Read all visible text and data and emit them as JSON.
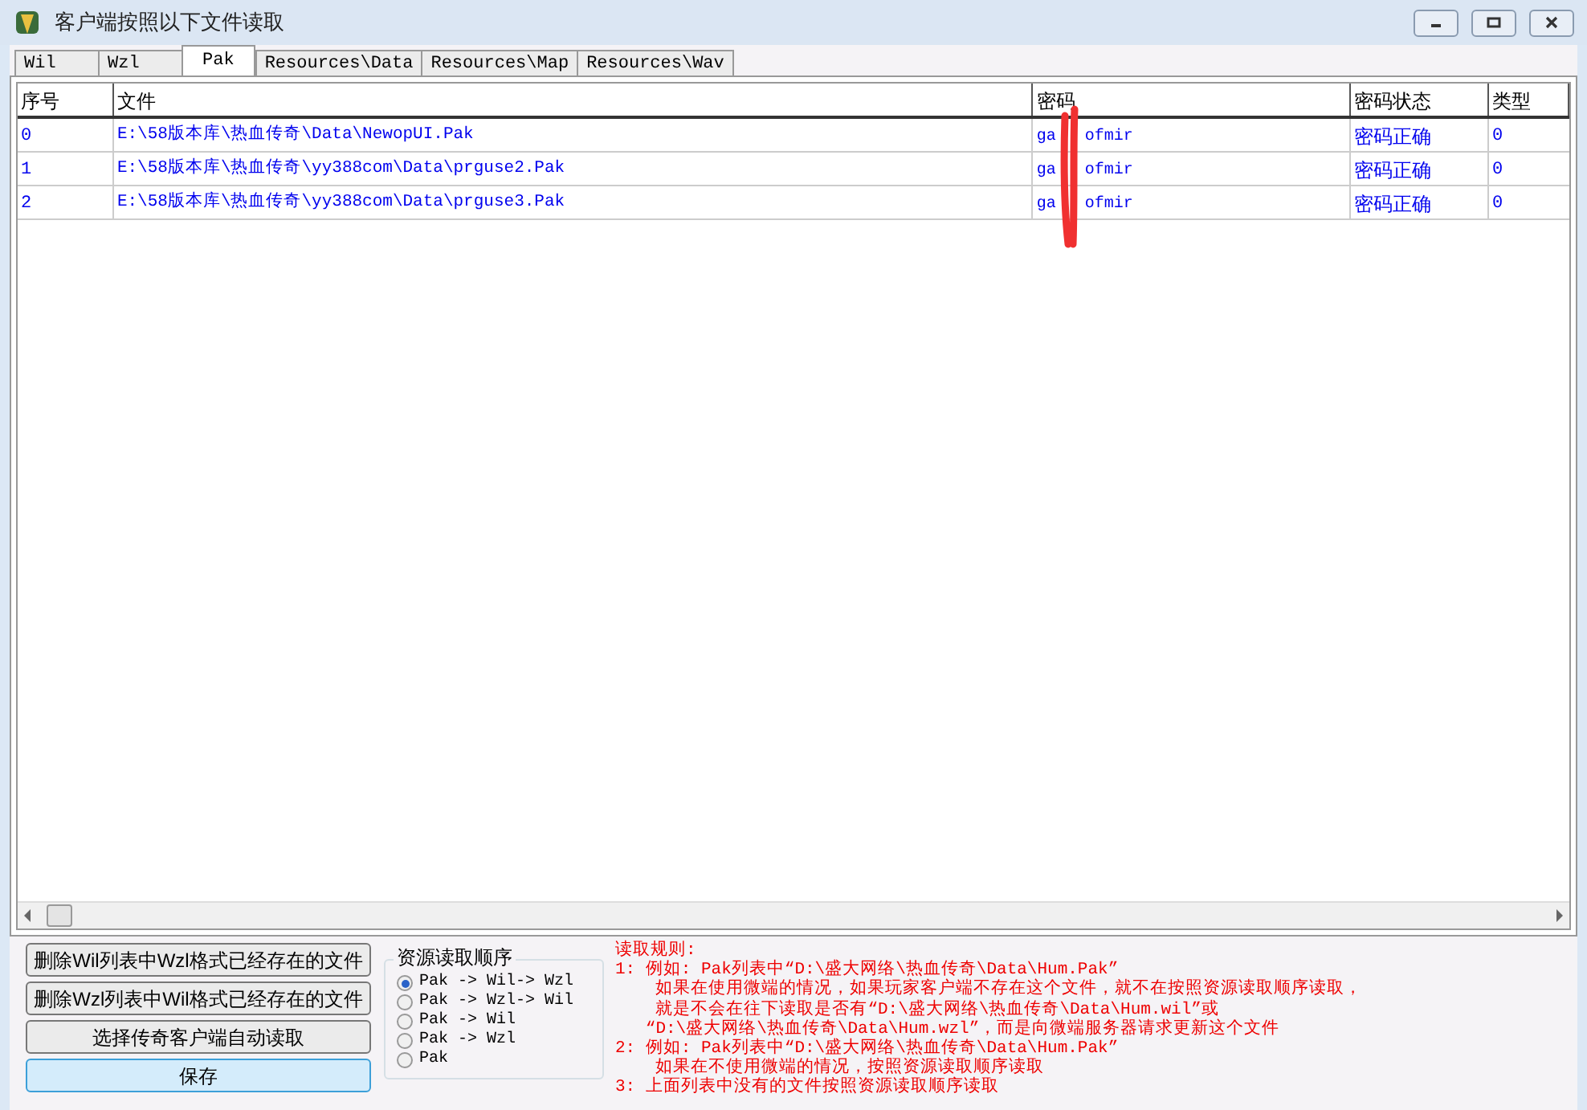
{
  "window": {
    "title": "客户端按照以下文件读取"
  },
  "tabs": [
    {
      "label": "Wil",
      "selected": false
    },
    {
      "label": "Wzl",
      "selected": false
    },
    {
      "label": "Pak",
      "selected": true
    },
    {
      "label": "Resources\\Data",
      "selected": false
    },
    {
      "label": "Resources\\Map",
      "selected": false
    },
    {
      "label": "Resources\\Wav",
      "selected": false
    }
  ],
  "table": {
    "columns": [
      "序号",
      "文件",
      "密码",
      "密码状态",
      "类型"
    ],
    "rows": [
      {
        "index": "0",
        "file": "E:\\58版本库\\热血传奇\\Data\\NewopUI.Pak",
        "password_start": "ga",
        "password_end": "ofmir",
        "status": "密码正确",
        "type": "0"
      },
      {
        "index": "1",
        "file": "E:\\58版本库\\热血传奇\\yy388com\\Data\\prguse2.Pak",
        "password_start": "ga",
        "password_end": "ofmir",
        "status": "密码正确",
        "type": "0"
      },
      {
        "index": "2",
        "file": "E:\\58版本库\\热血传奇\\yy388com\\Data\\prguse3.Pak",
        "password_start": "ga",
        "password_end": "ofmir",
        "status": "密码正确",
        "type": "0"
      }
    ]
  },
  "buttons": [
    {
      "label": "删除Wil列表中Wzl格式已经存在的文件",
      "kind": "normal"
    },
    {
      "label": "删除Wzl列表中Wil格式已经存在的文件",
      "kind": "normal"
    },
    {
      "label": "选择传奇客户端自动读取",
      "kind": "normal"
    },
    {
      "label": "保存",
      "kind": "default"
    }
  ],
  "order_group": {
    "title": "资源读取顺序",
    "options": [
      {
        "label": "Pak -> Wil-> Wzl",
        "selected": true
      },
      {
        "label": "Pak -> Wzl-> Wil",
        "selected": false
      },
      {
        "label": "Pak -> Wil",
        "selected": false
      },
      {
        "label": "Pak -> Wzl",
        "selected": false
      },
      {
        "label": "Pak",
        "selected": false
      }
    ]
  },
  "rules": [
    "读取规则:",
    "1: 例如: Pak列表中“D:\\盛大网络\\热血传奇\\Data\\Hum.Pak”",
    "    如果在使用微端的情况，如果玩家客户端不存在这个文件，就不在按照资源读取顺序读取，",
    "    就是不会在往下读取是否有“D:\\盛大网络\\热血传奇\\Data\\Hum.wil”或",
    "   “D:\\盛大网络\\热血传奇\\Data\\Hum.wzl”，而是向微端服务器请求更新这个文件",
    "2: 例如: Pak列表中“D:\\盛大网络\\热血传奇\\Data\\Hum.Pak”",
    "    如果在不使用微端的情况，按照资源读取顺序读取",
    "3: 上面列表中没有的文件按照资源读取顺序读取"
  ]
}
